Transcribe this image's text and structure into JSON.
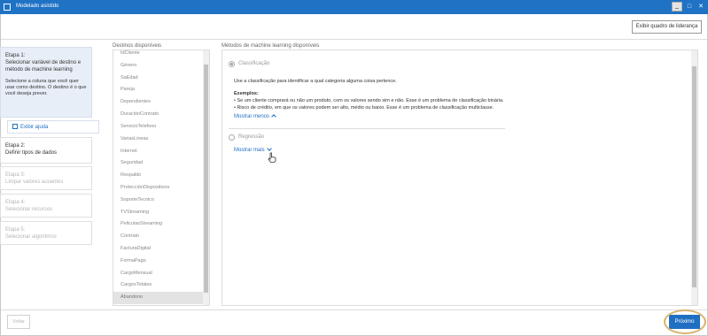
{
  "window": {
    "title": "Modelado asistido",
    "minimize_glyph": "_",
    "maximize_glyph": "□",
    "close_glyph": "✕"
  },
  "toolbar": {
    "leadership_button": "Exibir quadro de liderança"
  },
  "steps": [
    {
      "label": "Etapa 1:",
      "name": "Selecionar variável de destino e método de machine learning",
      "description": "Selecione a coluna que você quer usar como destino. O destino é o que você deseja prever.",
      "state": "active"
    },
    {
      "label": "Etapa 2:",
      "name": "Definir tipos de dados",
      "state": "enabled"
    },
    {
      "label": "Etapa 3:",
      "name": "Limpar valores ausentes",
      "state": "disabled"
    },
    {
      "label": "Etapa 4:",
      "name": "Selecionar recursos",
      "state": "disabled"
    },
    {
      "label": "Etapa 5:",
      "name": "Selecionar algoritmos",
      "state": "disabled"
    }
  ],
  "help": {
    "label": "Exibir ajuda",
    "icon": "external-link-icon"
  },
  "destinations": {
    "title": "Destinos disponíveis",
    "items": [
      "IdCliente",
      "Género",
      "SaEdad",
      "Pareja",
      "Dependientes",
      "DuraciónContrato",
      "ServicioTelefono",
      "VariasLineas",
      "Internet",
      "Seguridad",
      "Respaldo",
      "ProtecciónDispositivos",
      "SoporteTecnico",
      "TVStreaming",
      "PeliculasStreaming",
      "Contrato",
      "FacturaDigital",
      "FormaPago",
      "CargoMensual",
      "CargosTotales",
      "Abandono"
    ],
    "selected": "Abandono"
  },
  "methods": {
    "title": "Métodos de machine learning disponíveis",
    "classification": {
      "label": "Classificação",
      "description": "Use a classificação para identificar a qual categoria alguma coisa pertence.",
      "examples_title": "Exemplos:",
      "examples": [
        "• Se um cliente comprará ou não um produto, com os valores sendo sim e não. Esse é um problema de classificação binária.",
        "• Risco de crédito, em que os valores podem ser alto, médio ou baixo. Esse é um problema de classificação multiclasse."
      ],
      "toggle": "Mostrar menos",
      "selected": true
    },
    "regression": {
      "label": "Regressão",
      "toggle": "Mostrar mais",
      "selected": false
    }
  },
  "footer": {
    "back": "Voltar",
    "next": "Próximo"
  },
  "colors": {
    "accent": "#1f6fc2",
    "titlebar": "#1f72c4",
    "highlight": "#d9b36c"
  }
}
